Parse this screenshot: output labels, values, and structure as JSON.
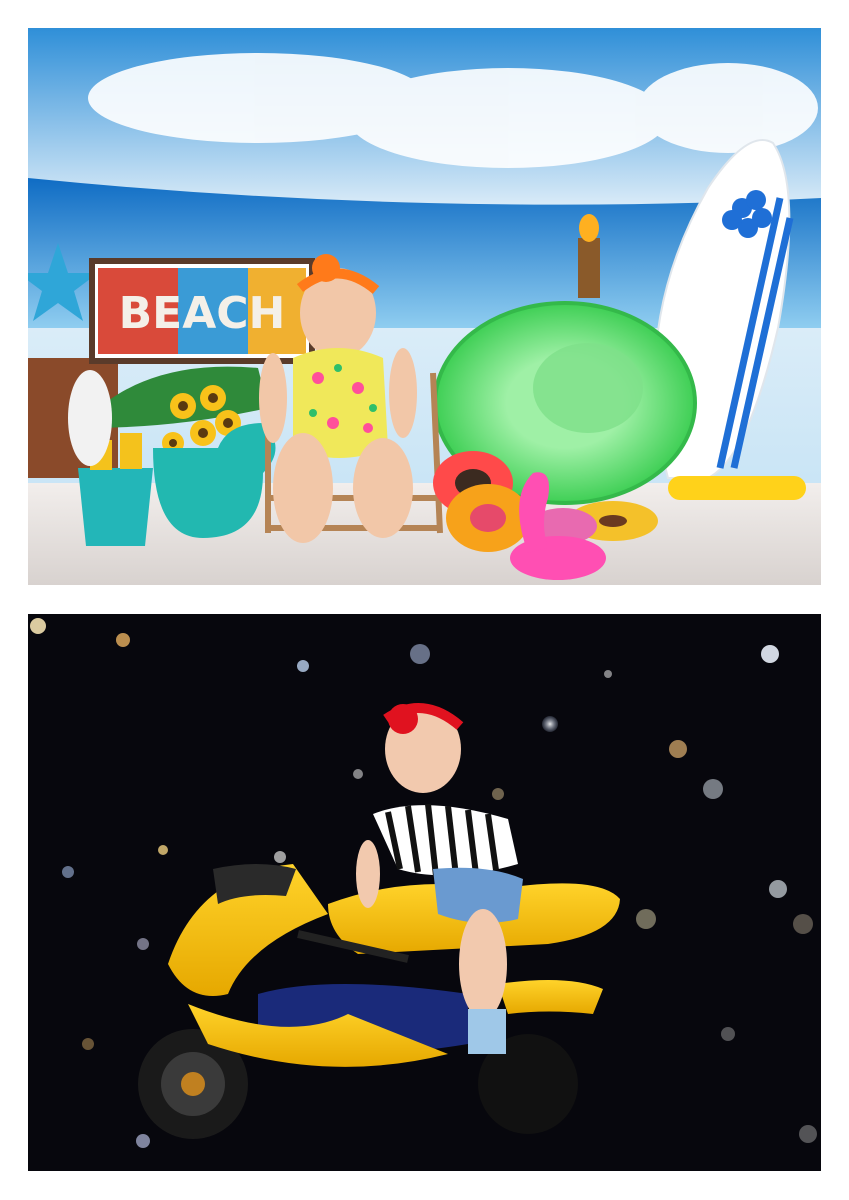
{
  "photos": [
    {
      "id_label": "beach-photo",
      "sign_text": "BEACH",
      "palette": {
        "sky": "#3aa0e0",
        "sea": "#1b7fd0",
        "floor": "#e9e6e4",
        "surfboard": "#ffffff",
        "stripe": "#1f6fd6",
        "ring": "#5fd86a",
        "flamingo": "#ff4fb3"
      }
    },
    {
      "id_label": "motorcycle-photo",
      "palette": {
        "background": "#0a0a14",
        "bike": "#f2c000",
        "shirt": "#111111",
        "bow": "#e0121f"
      }
    }
  ]
}
